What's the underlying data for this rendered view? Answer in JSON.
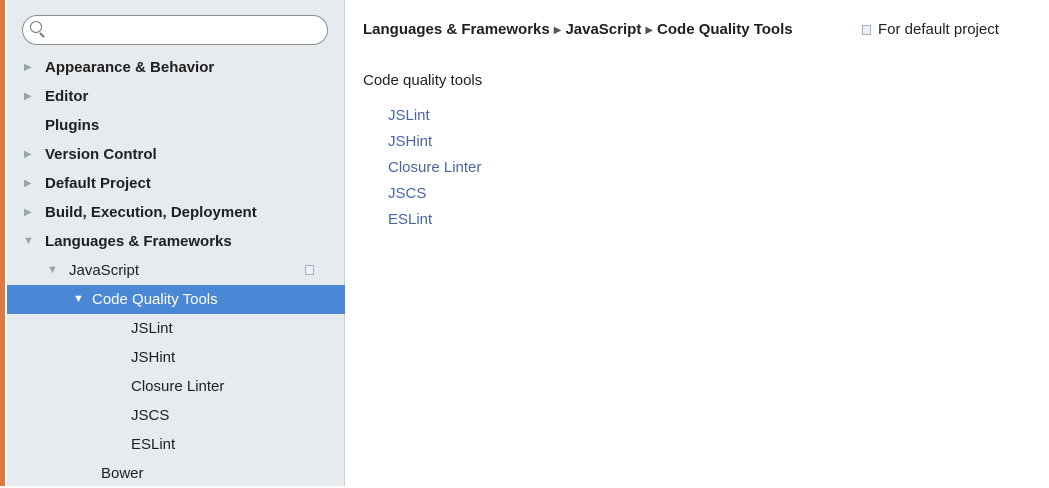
{
  "search": {
    "placeholder": "",
    "value": ""
  },
  "sidebar": {
    "items": [
      {
        "label": "Appearance & Behavior"
      },
      {
        "label": "Editor"
      },
      {
        "label": "Plugins"
      },
      {
        "label": "Version Control"
      },
      {
        "label": "Default Project"
      },
      {
        "label": "Build, Execution, Deployment"
      },
      {
        "label": "Languages & Frameworks"
      },
      {
        "label": "JavaScript"
      },
      {
        "label": "Code Quality Tools"
      },
      {
        "label": "JSLint"
      },
      {
        "label": "JSHint"
      },
      {
        "label": "Closure Linter"
      },
      {
        "label": "JSCS"
      },
      {
        "label": "ESLint"
      },
      {
        "label": "Bower"
      }
    ]
  },
  "header": {
    "breadcrumb": [
      "Languages & Frameworks",
      "JavaScript",
      "Code Quality Tools"
    ],
    "scope": "For default project"
  },
  "main": {
    "section_title": "Code quality tools",
    "links": [
      "JSLint",
      "JSHint",
      "Closure Linter",
      "JSCS",
      "ESLint"
    ]
  },
  "colors": {
    "accent_bar": "#dc7a45",
    "selection": "#4a88d6",
    "link": "#4867a6",
    "sidebar_bg": "#e6ebf0"
  },
  "icons": [
    "search-icon",
    "expand-arrow-icon",
    "collapse-arrow-icon",
    "project-scope-icon"
  ]
}
